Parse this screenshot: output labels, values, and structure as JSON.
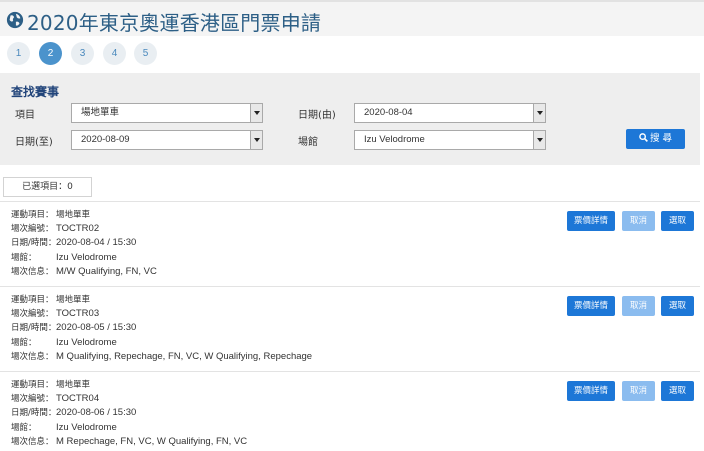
{
  "header": {
    "title": "2020年東京奧運香港區門票申請"
  },
  "steps": [
    "1",
    "2",
    "3",
    "4",
    "5"
  ],
  "active_step": "2",
  "search": {
    "title": "查找賽事",
    "sport_label": "項目",
    "sport_value": "場地單車",
    "date_from_label": "日期(由)",
    "date_from_value": "2020-08-04",
    "date_to_label": "日期(至)",
    "date_to_value": "2020-08-09",
    "venue_label": "場館",
    "venue_value": "Izu Velodrome",
    "search_button": "搜 尋"
  },
  "selected_label": "已選項目：0",
  "field_labels": {
    "sport": "運動項目：",
    "session": "場次編號：",
    "datetime": "日期/時間：",
    "venue": "場館：",
    "info": "場次信息："
  },
  "buttons": {
    "details": "票價詳情",
    "cancel": "取消",
    "select": "選取"
  },
  "sessions": [
    {
      "sport": "場地單車",
      "code": "TOCTR02",
      "datetime": "2020-08-04 / 15:30",
      "venue": "Izu Velodrome",
      "info": "M/W Qualifying, FN, VC"
    },
    {
      "sport": "場地單車",
      "code": "TOCTR03",
      "datetime": "2020-08-05 / 15:30",
      "venue": "Izu Velodrome",
      "info": "M Qualifying, Repechage, FN, VC, W Qualifying, Repechage"
    },
    {
      "sport": "場地單車",
      "code": "TOCTR04",
      "datetime": "2020-08-06 / 15:30",
      "venue": "Izu Velodrome",
      "info": "M Repechage, FN, VC, W Qualifying, FN, VC"
    }
  ],
  "colors": {
    "title": "#2d5f86",
    "primary": "#1d77d7",
    "primary_light": "#8bbcef",
    "step_active": "#4b93cc"
  }
}
